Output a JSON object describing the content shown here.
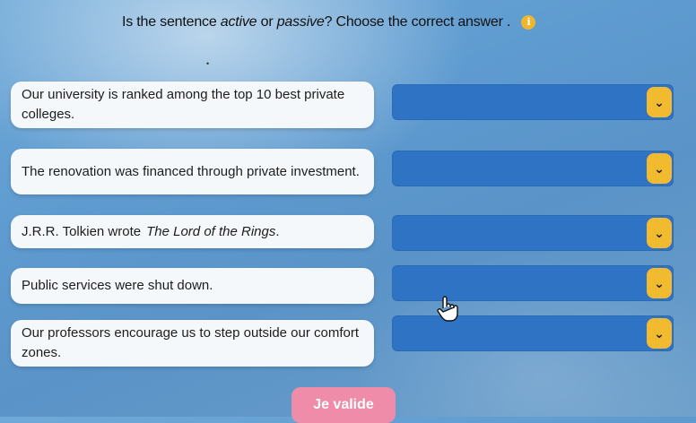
{
  "header": {
    "prefix": "Is the sentence ",
    "word_active": "active",
    "middle": " or ",
    "word_passive": "passive",
    "suffix": "? Choose the correct answer .",
    "info_icon": "i",
    "marker": "•"
  },
  "items": [
    {
      "sentence": "Our university is ranked among the top 10 best private colleges.",
      "selected": ""
    },
    {
      "sentence": "The renovation was financed through private investment.",
      "selected": ""
    },
    {
      "sentence_prefix": "J.R.R. Tolkien wrote",
      "sentence_italic": "The Lord of the Rings",
      "sentence_suffix": ".",
      "selected": ""
    },
    {
      "sentence": "Public services were shut down.",
      "selected": ""
    },
    {
      "sentence": "Our professors encourage us to step outside our comfort zones.",
      "selected": ""
    }
  ],
  "submit_label": "Je valide",
  "colors": {
    "select_bg": "#2f73c4",
    "chevron_bg": "#f1ba2f",
    "submit_bg": "#ee8ca9",
    "card_bg": "#f5f8fb"
  },
  "icons": {
    "chevron": "chevron-down-icon",
    "info": "info-icon",
    "cursor": "hand-pointer-icon"
  }
}
